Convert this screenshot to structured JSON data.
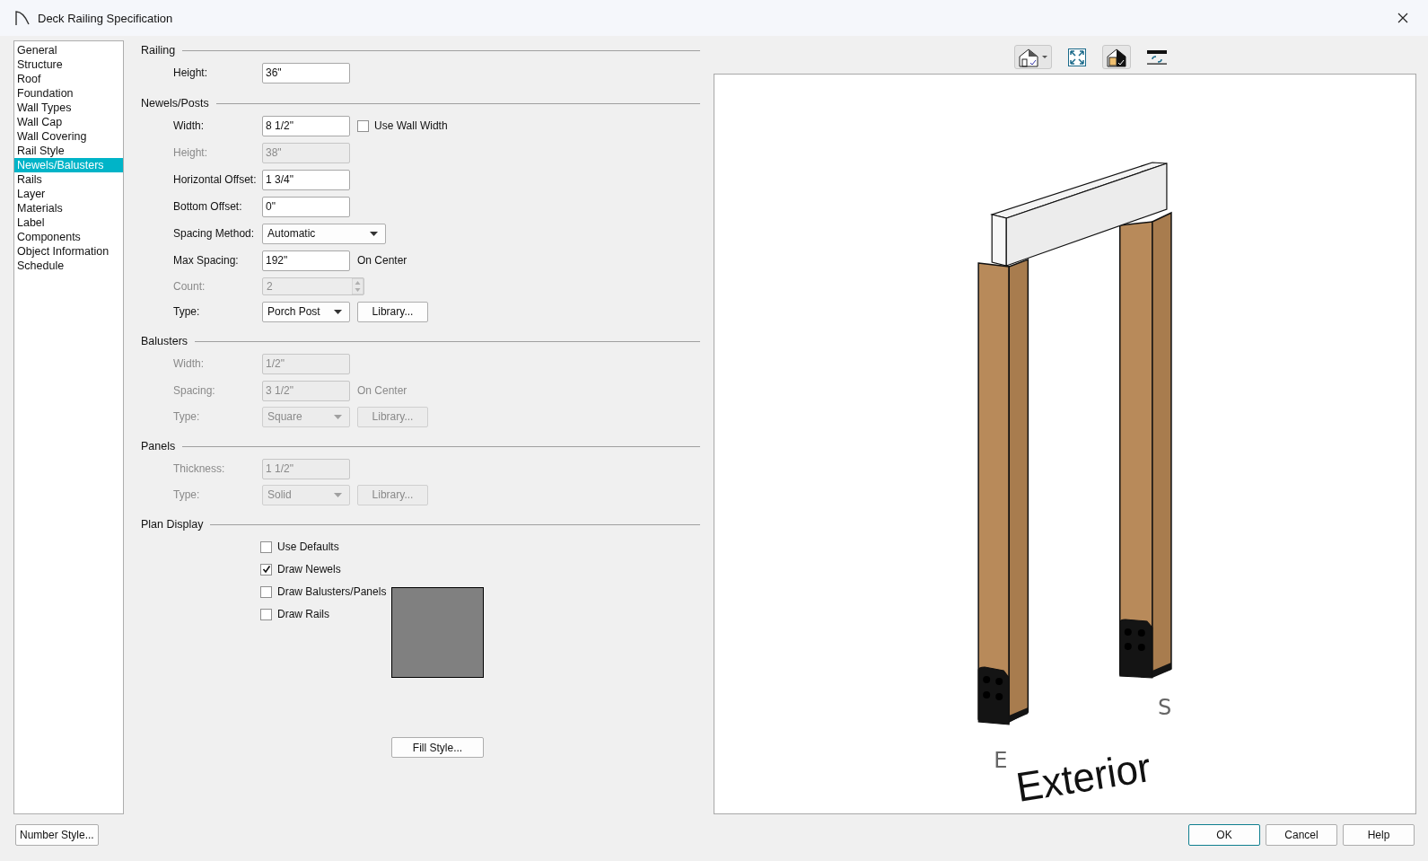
{
  "window": {
    "title": "Deck Railing Specification"
  },
  "sidebar": {
    "items": [
      {
        "label": "General",
        "selected": false
      },
      {
        "label": "Structure",
        "selected": false
      },
      {
        "label": "Roof",
        "selected": false
      },
      {
        "label": "Foundation",
        "selected": false
      },
      {
        "label": "Wall Types",
        "selected": false
      },
      {
        "label": "Wall Cap",
        "selected": false
      },
      {
        "label": "Wall Covering",
        "selected": false
      },
      {
        "label": "Rail Style",
        "selected": false
      },
      {
        "label": "Newels/Balusters",
        "selected": true
      },
      {
        "label": "Rails",
        "selected": false
      },
      {
        "label": "Layer",
        "selected": false
      },
      {
        "label": "Materials",
        "selected": false
      },
      {
        "label": "Label",
        "selected": false
      },
      {
        "label": "Components",
        "selected": false
      },
      {
        "label": "Object Information",
        "selected": false
      },
      {
        "label": "Schedule",
        "selected": false
      }
    ]
  },
  "sections": [
    {
      "title": "Railing",
      "rows": [
        {
          "kind": "field",
          "label": "Height:",
          "value": "36\"",
          "disabled": false
        }
      ]
    },
    {
      "title": "Newels/Posts",
      "rows": [
        {
          "kind": "field",
          "label": "Width:",
          "value": "8 1/2\"",
          "disabled": false,
          "checkbox": {
            "label": "Use Wall Width",
            "checked": false
          }
        },
        {
          "kind": "field",
          "label": "Height:",
          "value": "38\"",
          "disabled": true
        },
        {
          "kind": "field",
          "label": "Horizontal Offset:",
          "value": "1 3/4\"",
          "disabled": false
        },
        {
          "kind": "field",
          "label": "Bottom Offset:",
          "value": "0\"",
          "disabled": false
        },
        {
          "kind": "select",
          "label": "Spacing Method:",
          "value": "Automatic",
          "disabled": false
        },
        {
          "kind": "field",
          "label": "Max Spacing:",
          "value": "192\"",
          "disabled": false,
          "suffix": "On Center"
        },
        {
          "kind": "spinner",
          "label": "Count:",
          "value": "2",
          "disabled": true
        },
        {
          "kind": "select",
          "label": "Type:",
          "value": "Porch Post",
          "disabled": false,
          "button": "Library..."
        }
      ]
    },
    {
      "title": "Balusters",
      "rows": [
        {
          "kind": "field",
          "label": "Width:",
          "value": "1/2\"",
          "disabled": true
        },
        {
          "kind": "field",
          "label": "Spacing:",
          "value": "3 1/2\"",
          "disabled": true,
          "suffix": "On Center"
        },
        {
          "kind": "select",
          "label": "Type:",
          "value": "Square",
          "disabled": true,
          "button": "Library..."
        }
      ]
    },
    {
      "title": "Panels",
      "rows": [
        {
          "kind": "field",
          "label": "Thickness:",
          "value": "1 1/2\"",
          "disabled": true
        },
        {
          "kind": "select",
          "label": "Type:",
          "value": "Solid",
          "disabled": true,
          "button": "Library..."
        }
      ]
    }
  ],
  "plan_display": {
    "title": "Plan Display",
    "checkboxes": [
      {
        "label": "Use Defaults",
        "checked": false
      },
      {
        "label": "Draw Newels",
        "checked": true
      },
      {
        "label": "Draw Balusters/Panels",
        "checked": false
      },
      {
        "label": "Draw Rails",
        "checked": false
      }
    ],
    "fill_button": "Fill Style..."
  },
  "preview": {
    "labels": [
      {
        "text": "E"
      },
      {
        "text": "S"
      },
      {
        "text": "Exterior"
      }
    ]
  },
  "footer": {
    "number_style": "Number Style...",
    "buttons": [
      {
        "label": "OK",
        "default": true
      },
      {
        "label": "Cancel",
        "default": false
      },
      {
        "label": "Help",
        "default": false
      }
    ]
  }
}
